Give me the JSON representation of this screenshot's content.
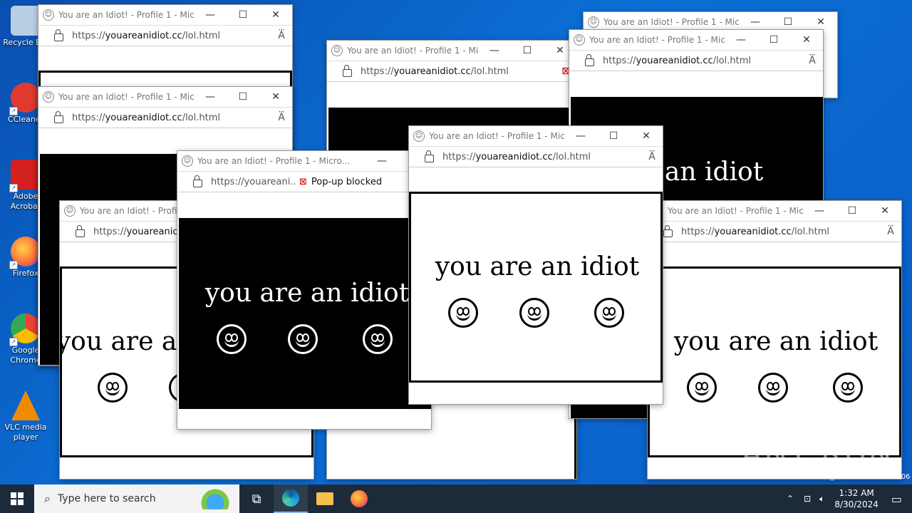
{
  "desktop": {
    "icons": [
      {
        "label": "Recycle Bin",
        "icon": "recycle-bin-icon",
        "color": "#9fb8d0"
      },
      {
        "label": "CCleaner",
        "icon": "ccleaner-icon",
        "color": "#e03a2f"
      },
      {
        "label": "Adobe Acrobat",
        "icon": "adobe-acrobat-icon",
        "color": "#d4201f"
      },
      {
        "label": "Firefox",
        "icon": "firefox-icon",
        "color": "#ff7139"
      },
      {
        "label": "Google Chrome",
        "icon": "chrome-icon",
        "color": "#34a853"
      },
      {
        "label": "VLC media player",
        "icon": "vlc-icon",
        "color": "#f08a00"
      }
    ]
  },
  "browser": {
    "window_title": "You are an Idiot! - Profile 1 - Micro...",
    "url_prefix": "https://",
    "url_domain": "youareanidiot.cc",
    "url_path": "/lol.html",
    "url_truncated": "https://youareani...",
    "popup_blocked": "Pop-up blocked",
    "read_aloud": "A⃛",
    "minimize": "—",
    "maximize": "☐",
    "close": "✕"
  },
  "page": {
    "phrase": "you are an idiot"
  },
  "taskbar": {
    "search_placeholder": "Type here to search",
    "time": "1:32 AM",
    "date": "8/30/2024"
  },
  "watermark": {
    "text": "ANY RUN",
    "build": "Build 19041.vb_release.191206-1406"
  }
}
